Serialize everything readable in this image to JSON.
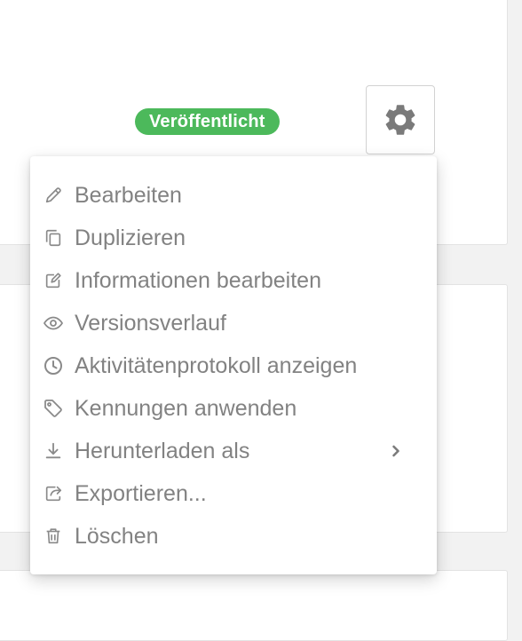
{
  "status_badge": {
    "label": "Veröffentlicht",
    "color": "#4cb95b"
  },
  "settings_button": {
    "icon": "gear-icon"
  },
  "menu": {
    "text_color": "#828282",
    "items": [
      {
        "label": "Bearbeiten",
        "icon": "pencil-icon"
      },
      {
        "label": "Duplizieren",
        "icon": "copy-icon"
      },
      {
        "label": "Informationen bearbeiten",
        "icon": "edit-square-icon"
      },
      {
        "label": "Versionsverlauf",
        "icon": "eye-icon"
      },
      {
        "label": "Aktivitätenprotokoll anzeigen",
        "icon": "clock-icon"
      },
      {
        "label": "Kennungen anwenden",
        "icon": "tag-icon"
      },
      {
        "label": "Herunterladen als",
        "icon": "download-icon",
        "submenu": "chevron-right-icon"
      },
      {
        "label": "Exportieren...",
        "icon": "export-icon"
      },
      {
        "label": "Löschen",
        "icon": "trash-icon"
      }
    ]
  }
}
